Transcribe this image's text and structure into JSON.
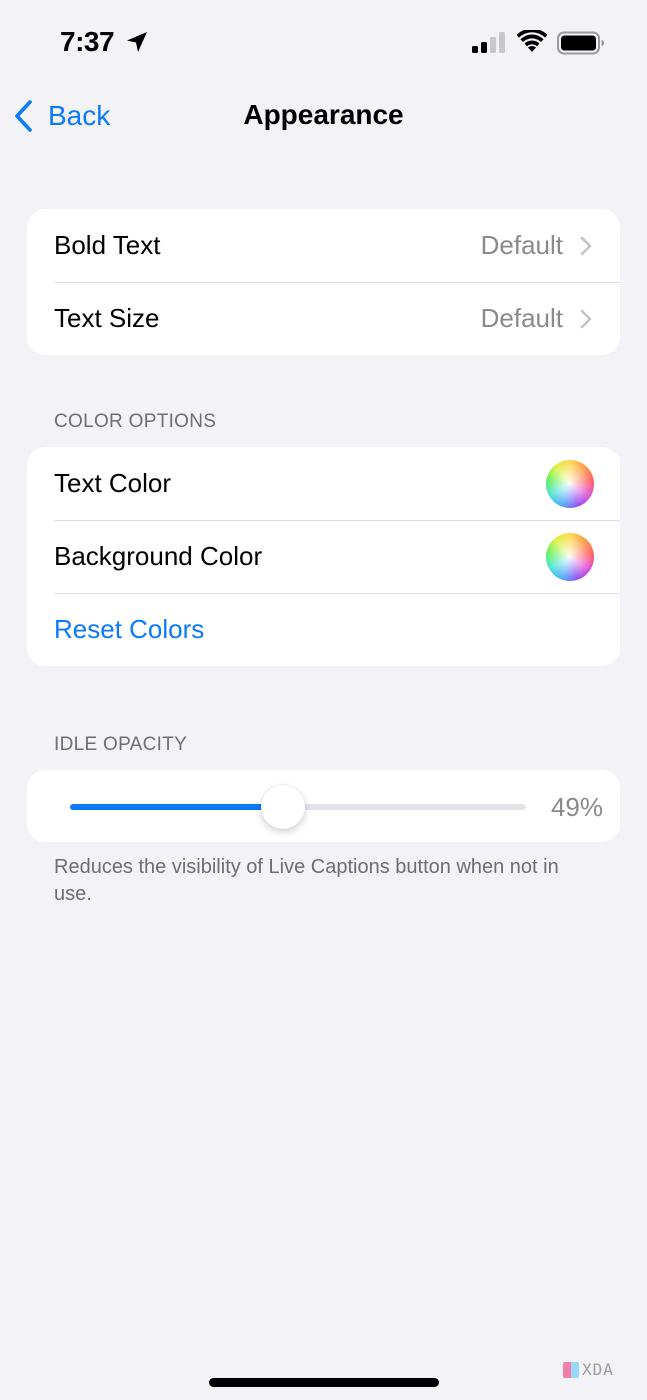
{
  "status_bar": {
    "time": "7:37",
    "icons": [
      "location-arrow-icon",
      "cellular-signal-icon",
      "wifi-icon",
      "battery-icon"
    ]
  },
  "nav": {
    "back_label": "Back",
    "title": "Appearance"
  },
  "text_group": {
    "rows": [
      {
        "label": "Bold Text",
        "value": "Default"
      },
      {
        "label": "Text Size",
        "value": "Default"
      }
    ]
  },
  "color_options": {
    "header": "COLOR OPTIONS",
    "rows": [
      {
        "label": "Text Color",
        "control": "color-well"
      },
      {
        "label": "Background Color",
        "control": "color-well"
      }
    ],
    "reset_label": "Reset Colors"
  },
  "idle_opacity": {
    "header": "IDLE OPACITY",
    "value_percent": 49,
    "value_label": "49%",
    "footer": "Reduces the visibility of Live Captions button when not in use."
  },
  "colors": {
    "accent": "#0a7aff",
    "background": "#f2f2f7",
    "secondary_text": "#8a8a8e"
  },
  "watermark": {
    "text": "XDA"
  }
}
